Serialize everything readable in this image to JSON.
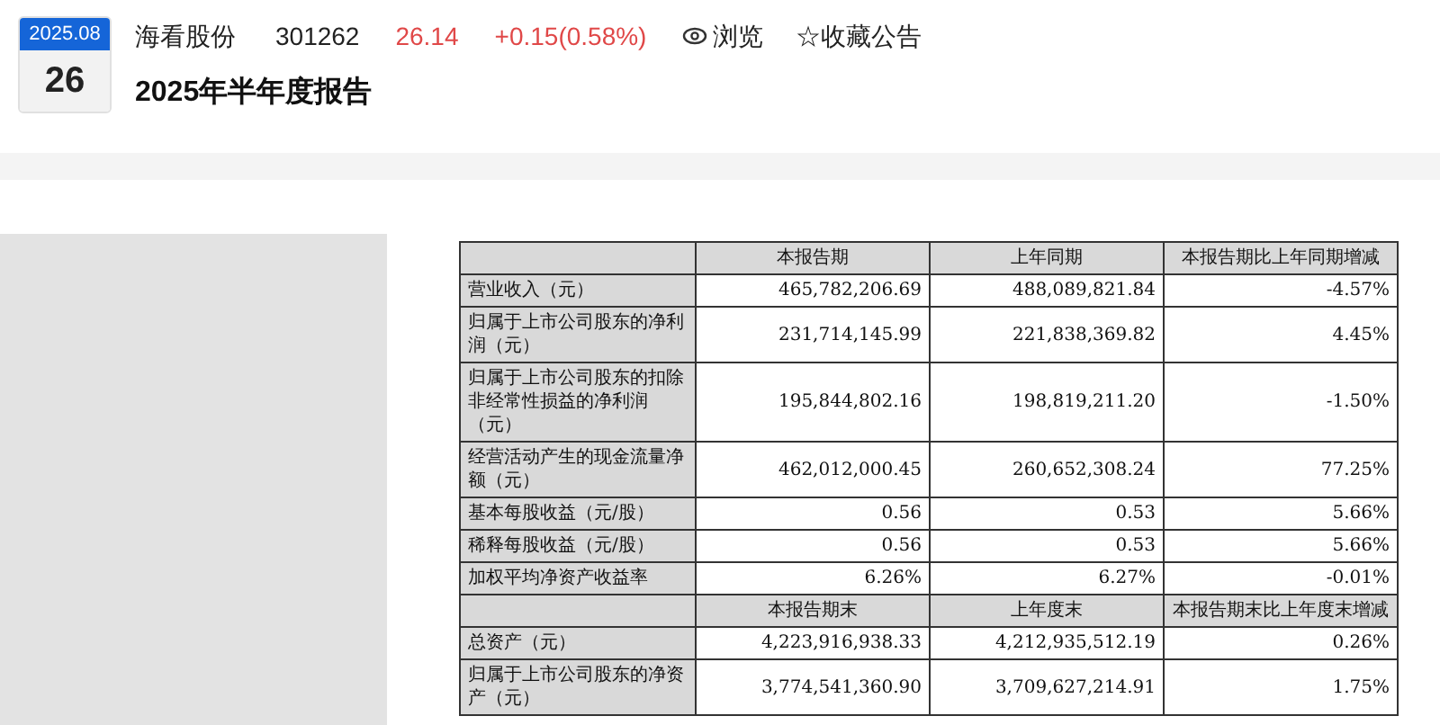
{
  "header": {
    "date_month": "2025.08",
    "date_day": "26",
    "company": "海看股份",
    "code": "301262",
    "price": "26.14",
    "change": "+0.15(0.58%)",
    "browse": "浏览",
    "favorite": "☆收藏公告",
    "title": "2025年半年度报告"
  },
  "table": {
    "rows": [
      {
        "kind": "header",
        "cells": [
          "",
          "本报告期",
          "上年同期",
          "本报告期比上年同期增减"
        ]
      },
      {
        "kind": "data",
        "cells": [
          "营业收入（元）",
          "465,782,206.69",
          "488,089,821.84",
          "-4.57%"
        ]
      },
      {
        "kind": "data",
        "cells": [
          "归属于上市公司股东的净利润（元）",
          "231,714,145.99",
          "221,838,369.82",
          "4.45%"
        ]
      },
      {
        "kind": "data",
        "cells": [
          "归属于上市公司股东的扣除非经常性损益的净利润（元）",
          "195,844,802.16",
          "198,819,211.20",
          "-1.50%"
        ]
      },
      {
        "kind": "data",
        "cells": [
          "经营活动产生的现金流量净额（元）",
          "462,012,000.45",
          "260,652,308.24",
          "77.25%"
        ]
      },
      {
        "kind": "data",
        "cells": [
          "基本每股收益（元/股）",
          "0.56",
          "0.53",
          "5.66%"
        ]
      },
      {
        "kind": "data",
        "cells": [
          "稀释每股收益（元/股）",
          "0.56",
          "0.53",
          "5.66%"
        ]
      },
      {
        "kind": "data",
        "cells": [
          "加权平均净资产收益率",
          "6.26%",
          "6.27%",
          "-0.01%"
        ]
      },
      {
        "kind": "header",
        "cells": [
          "",
          "本报告期末",
          "上年度末",
          "本报告期末比上年度末增减"
        ]
      },
      {
        "kind": "data",
        "cells": [
          "总资产（元）",
          "4,223,916,938.33",
          "4,212,935,512.19",
          "0.26%"
        ]
      },
      {
        "kind": "data",
        "cells": [
          "归属于上市公司股东的净资产（元）",
          "3,774,541,360.90",
          "3,709,627,214.91",
          "1.75%"
        ]
      }
    ]
  }
}
